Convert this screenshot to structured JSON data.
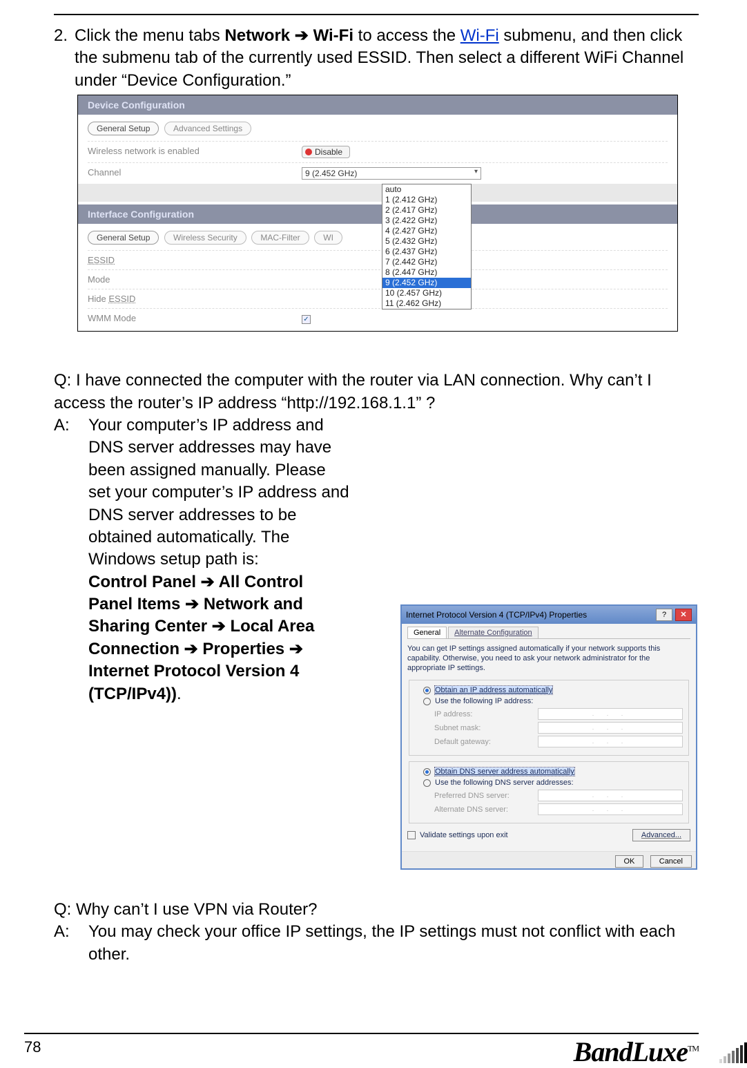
{
  "step": {
    "num": "2.",
    "t1a": "Click the menu tabs ",
    "t1b_bold": "Network ➔ Wi-Fi",
    "t1c": " to access the ",
    "t1d_link": "Wi-Fi",
    "t2": "submenu, and then click the submenu tab of the currently used ESSID. Then select a different WiFi Channel under “Device Configuration.”"
  },
  "shot1": {
    "hdr1": "Device Configuration",
    "tabs1": {
      "a": "General Setup",
      "b": "Advanced Settings"
    },
    "row_wireless": "Wireless network is enabled",
    "disable_btn": "Disable",
    "row_channel": "Channel",
    "channel_selected": "9 (2.452 GHz)",
    "dropdown": [
      "auto",
      "1 (2.412 GHz)",
      "2 (2.417 GHz)",
      "3 (2.422 GHz)",
      "4 (2.427 GHz)",
      "5 (2.432 GHz)",
      "6 (2.437 GHz)",
      "7 (2.442 GHz)",
      "8 (2.447 GHz)",
      "9 (2.452 GHz)",
      "10 (2.457 GHz)",
      "11 (2.462 GHz)"
    ],
    "hdr2": "Interface Configuration",
    "tabs2": {
      "a": "General Setup",
      "b": "Wireless Security",
      "c": "MAC-Filter",
      "d": "WI"
    },
    "row_essid": "ESSID",
    "row_mode": "Mode",
    "row_hide": "Hide ",
    "row_hide_u": "ESSID",
    "row_wmm": "WMM Mode"
  },
  "qa1": {
    "q": "Q: I have connected the computer with the router via LAN connection. Why can’t I access the router’s IP address “http://192.168.1.1” ?",
    "a_label": "A:",
    "a_body1": "Your computer’s IP address and DNS server addresses may have been assigned manually. Please set your computer’s IP address and DNS server addresses to be obtained automatically. The Windows setup path is:",
    "a_body2_bold": "Control Panel ➔ All Control Panel Items ➔ Network and Sharing Center ➔ Local Area Connection ➔ Properties ➔ Internet Protocol Version 4 (TCP/IPv4))",
    "a_body2_end": "."
  },
  "shot2": {
    "title": "Internet Protocol Version 4 (TCP/IPv4) Properties",
    "help": "?",
    "close": "✕",
    "tab_general": "General",
    "tab_alt": "Alternate Configuration",
    "desc": "You can get IP settings assigned automatically if your network supports this capability. Otherwise, you need to ask your network administrator for the appropriate IP settings.",
    "opt_auto_ip": "Obtain an IP address automatically",
    "opt_use_ip": "Use the following IP address:",
    "f_ip": "IP address:",
    "f_mask": "Subnet mask:",
    "f_gw": "Default gateway:",
    "opt_auto_dns": "Obtain DNS server address automatically",
    "opt_use_dns": "Use the following DNS server addresses:",
    "f_pdns": "Preferred DNS server:",
    "f_adns": "Alternate DNS server:",
    "validate": "Validate settings upon exit",
    "advanced": "Advanced...",
    "ok": "OK",
    "cancel": "Cancel"
  },
  "qa2": {
    "q": "Q: Why can’t I use VPN via Router?",
    "a_label": "A:",
    "a_body": "You may check your office IP settings, the IP settings must not conflict with each other."
  },
  "footer": {
    "page": "78",
    "brand": "BandLuxe",
    "tm": "TM"
  }
}
